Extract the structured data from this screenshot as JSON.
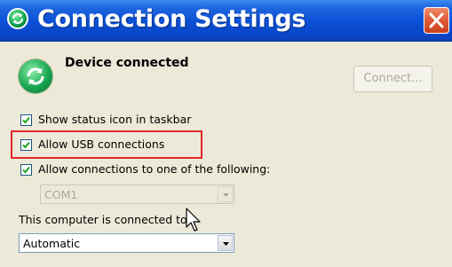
{
  "window": {
    "title": "Connection Settings",
    "title_icon": "sync-icon",
    "close_icon": "close-icon"
  },
  "status": {
    "icon": "sync-icon",
    "text": "Device connected"
  },
  "connect_button": {
    "label": "Connect...",
    "enabled": false
  },
  "options": [
    {
      "label": "Show status icon in taskbar",
      "checked": true
    },
    {
      "label": "Allow USB connections",
      "checked": true,
      "highlighted": true
    },
    {
      "label": "Allow connections to one of the following:",
      "checked": true
    }
  ],
  "port_select": {
    "value": "COM1",
    "enabled": false
  },
  "pc_connection": {
    "label": "This computer is connected to:",
    "value": "Automatic"
  },
  "colors": {
    "titlebar": "#0a4fd6",
    "highlight_box": "#e0282a",
    "close_button": "#e15a36",
    "status_icon": "#19a651"
  }
}
